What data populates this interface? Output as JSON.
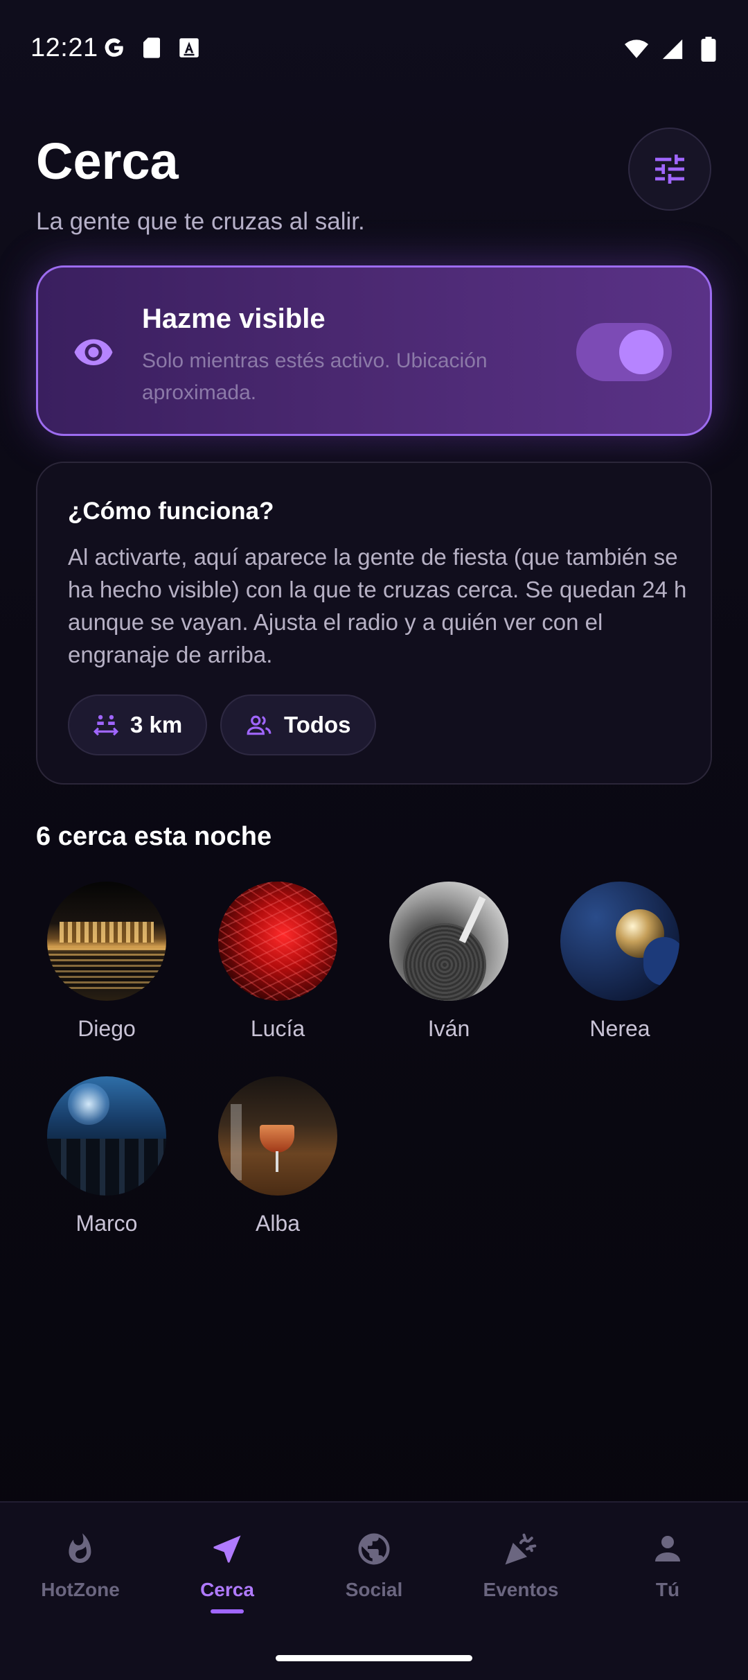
{
  "status_bar": {
    "time": "12:21",
    "left_icons": [
      "google-icon",
      "sd-card-icon",
      "a-box-icon"
    ],
    "right_icons": [
      "wifi-icon",
      "cell-signal-icon",
      "battery-icon"
    ]
  },
  "header": {
    "title": "Cerca",
    "subtitle": "La gente que te cruzas al salir.",
    "filter_icon": "tune-icon"
  },
  "visibility": {
    "title": "Hazme visible",
    "description": "Solo mientras estés activo. Ubicación aproximada.",
    "enabled": true,
    "accent": "#b684ff"
  },
  "how_it_works": {
    "title": "¿Cómo funciona?",
    "body": "Al activarte, aquí aparece la gente de fiesta (que también se ha hecho visible) con la que te cruzas cerca. Se quedan 24 h aunque se vayan. Ajusta el radio y a quién ver con el engranaje de arriba.",
    "chips": [
      {
        "label": "3 km",
        "icon": "distance-icon"
      },
      {
        "label": "Todos",
        "icon": "people-icon"
      }
    ]
  },
  "nearby": {
    "title": "6 cerca esta noche",
    "people": [
      {
        "name": "Diego"
      },
      {
        "name": "Lucía"
      },
      {
        "name": "Iván"
      },
      {
        "name": "Nerea"
      },
      {
        "name": "Marco"
      },
      {
        "name": "Alba"
      }
    ]
  },
  "bottom_nav": {
    "items": [
      {
        "label": "HotZone",
        "icon": "flame-icon"
      },
      {
        "label": "Cerca",
        "icon": "navigation-arrow-icon",
        "active": true
      },
      {
        "label": "Social",
        "icon": "globe-icon"
      },
      {
        "label": "Eventos",
        "icon": "party-popper-icon"
      },
      {
        "label": "Tú",
        "icon": "person-icon"
      }
    ],
    "active_color": "#b07aff",
    "inactive_color": "#6b6680"
  }
}
